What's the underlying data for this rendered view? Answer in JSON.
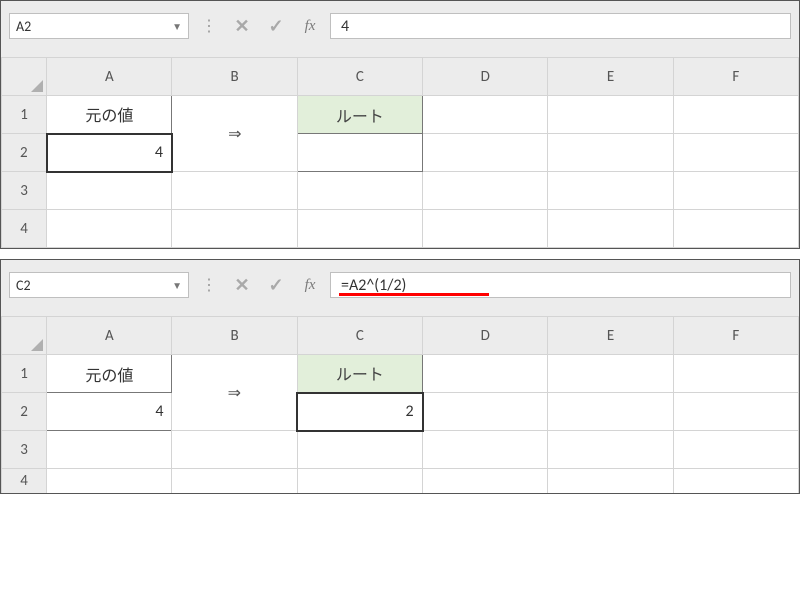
{
  "panel1": {
    "name_box": "A2",
    "dropdown_glyph": "▼",
    "sep": "⋮",
    "cancel_glyph": "✕",
    "confirm_glyph": "✓",
    "fx_label": "fx",
    "formula_value": "4",
    "columns": [
      "A",
      "B",
      "C",
      "D",
      "E",
      "F"
    ],
    "row_headers": [
      "1",
      "2",
      "3",
      "4"
    ],
    "a1": "元の値",
    "a2": "4",
    "b_arrow": "⇒",
    "c1": "ルート",
    "c2": ""
  },
  "panel2": {
    "name_box": "C2",
    "dropdown_glyph": "▼",
    "sep": "⋮",
    "cancel_glyph": "✕",
    "confirm_glyph": "✓",
    "fx_label": "fx",
    "formula_value": "=A2^(1/2)",
    "columns": [
      "A",
      "B",
      "C",
      "D",
      "E",
      "F"
    ],
    "row_headers": [
      "1",
      "2",
      "3",
      "4"
    ],
    "a1": "元の値",
    "a2": "4",
    "b_arrow": "⇒",
    "c1": "ルート",
    "c2": "2"
  }
}
